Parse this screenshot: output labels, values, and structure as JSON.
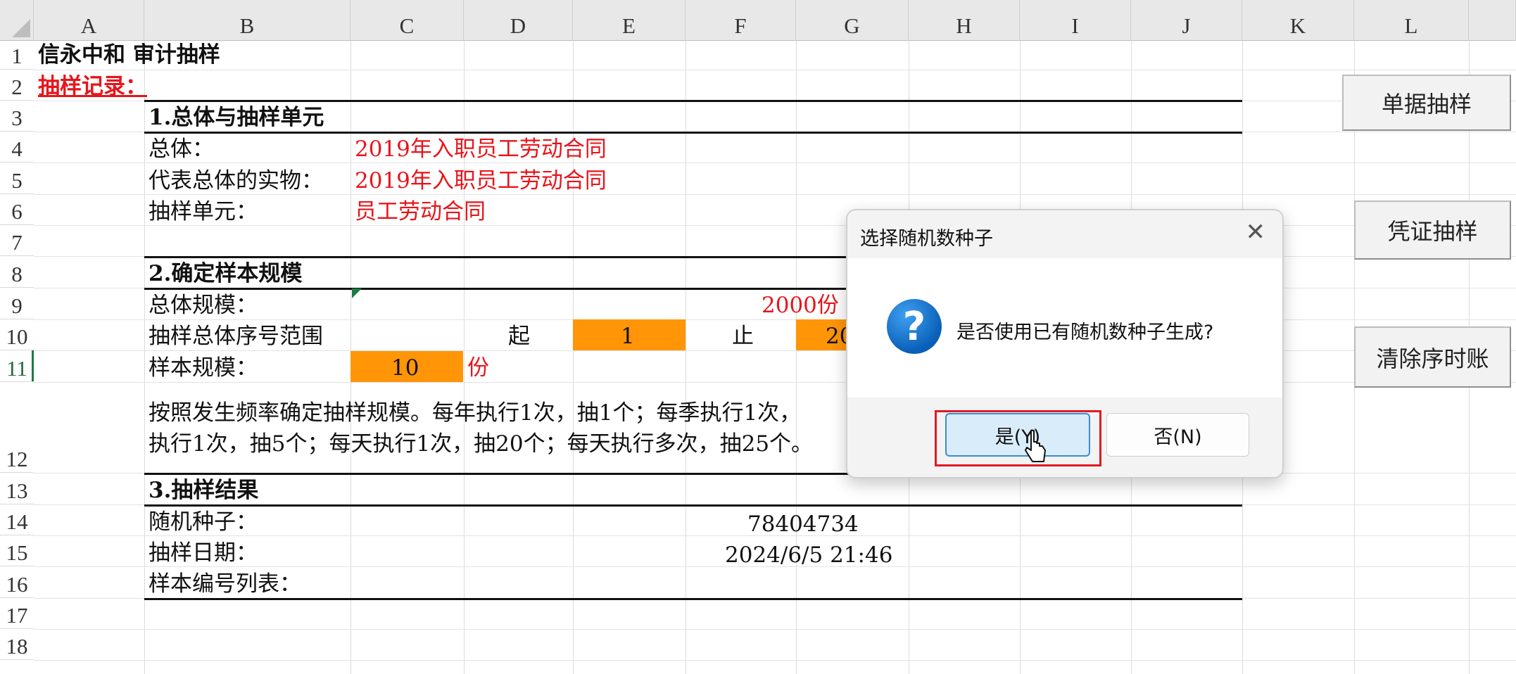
{
  "sheet": {
    "columns": [
      "A",
      "B",
      "C",
      "D",
      "E",
      "F",
      "G",
      "H",
      "I",
      "J",
      "K",
      "L"
    ],
    "rows": [
      "1",
      "2",
      "3",
      "4",
      "5",
      "6",
      "7",
      "8",
      "9",
      "10",
      "11",
      "12",
      "13",
      "14",
      "15",
      "16",
      "17",
      "18"
    ]
  },
  "content": {
    "title": "信永中和  审计抽样",
    "record_label": "抽样记录：",
    "s1_heading": "1.总体与抽样单元",
    "population_label": "总体：",
    "population_value": "2019年入职员工劳动合同",
    "physical_label": "代表总体的实物：",
    "physical_value": "2019年入职员工劳动合同",
    "unit_label": "抽样单元：",
    "unit_value": "员工劳动合同",
    "s2_heading": "2.确定样本规模",
    "pop_size_label": "总体规模：",
    "pop_size_value": "2000份",
    "range_label": "抽样总体序号范围",
    "range_start_label": "起",
    "range_start_value": "1",
    "range_end_label": "止",
    "range_end_value": "20",
    "sample_size_label": "样本规模：",
    "sample_size_value": "10",
    "sample_size_unit": "份",
    "note_line1": "按照发生频率确定抽样规模。每年执行1次，抽1个；每季执行1次，",
    "note_line2": "执行1次，抽5个；每天执行1次，抽20个；每天执行多次，抽25个。",
    "s3_heading": "3.抽样结果",
    "seed_label": "随机种子：",
    "seed_value": "78404734",
    "date_label": "抽样日期：",
    "date_value": "2024/6/5 21:46",
    "list_label": "样本编号列表："
  },
  "buttons": {
    "doc_sampling": "单据抽样",
    "voucher_sampling": "凭证抽样",
    "clear_ledger": "清除序时账"
  },
  "dialog": {
    "title": "选择随机数种子",
    "close_glyph": "✕",
    "icon_glyph": "?",
    "message": "是否使用已有随机数种子生成?",
    "yes_label": "是(Y)",
    "no_label": "否(N)"
  }
}
